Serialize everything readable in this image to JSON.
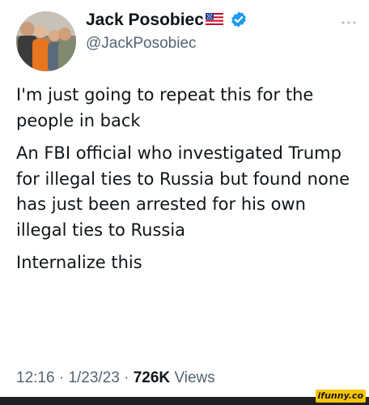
{
  "author": {
    "display_name": "Jack Posobiec",
    "handle": "@JackPosobiec",
    "flag_icon": "us-flag-icon",
    "verified_icon": "verified-badge-icon",
    "verified_color": "#1d9bf0"
  },
  "tweet": {
    "paragraphs": [
      "I'm just going to repeat this for the people in back",
      "An FBI official who investigated Trump for illegal ties to Russia but found none has just been arrested for his own illegal ties to Russia",
      "Internalize this"
    ]
  },
  "meta": {
    "time": "12:16",
    "separator": "·",
    "date": "1/23/23",
    "views_count": "726K",
    "views_label": "Views"
  },
  "watermark": {
    "text": "ifunny.co"
  },
  "colors": {
    "text": "#0f1419",
    "secondary": "#536471",
    "watermark_bg": "#f5c400"
  }
}
